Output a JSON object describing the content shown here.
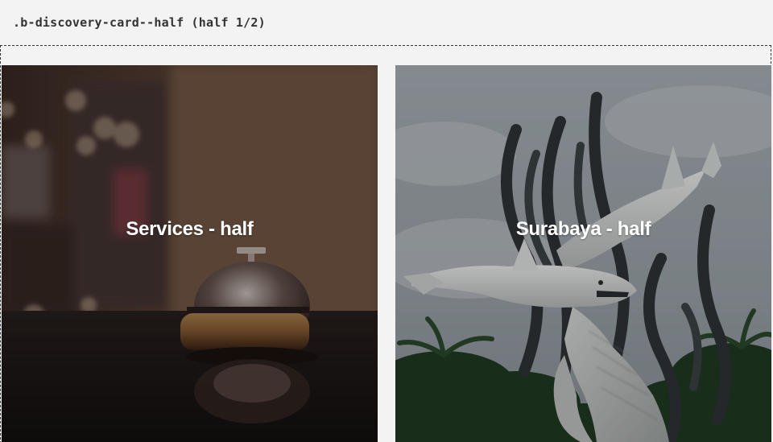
{
  "section_label": ".b-discovery-card--half (half 1/2)",
  "cards": [
    {
      "title": "Services - half",
      "image": "hotel-service-bell-photo"
    },
    {
      "title": "Surabaya - half",
      "image": "surabaya-shark-crocodile-statue-photo"
    }
  ],
  "colors": {
    "page_background": "#f3f3f3",
    "frame_border": "#333333",
    "title_text": "#ffffff",
    "overlay": "rgba(0,0,0,0.3)"
  }
}
